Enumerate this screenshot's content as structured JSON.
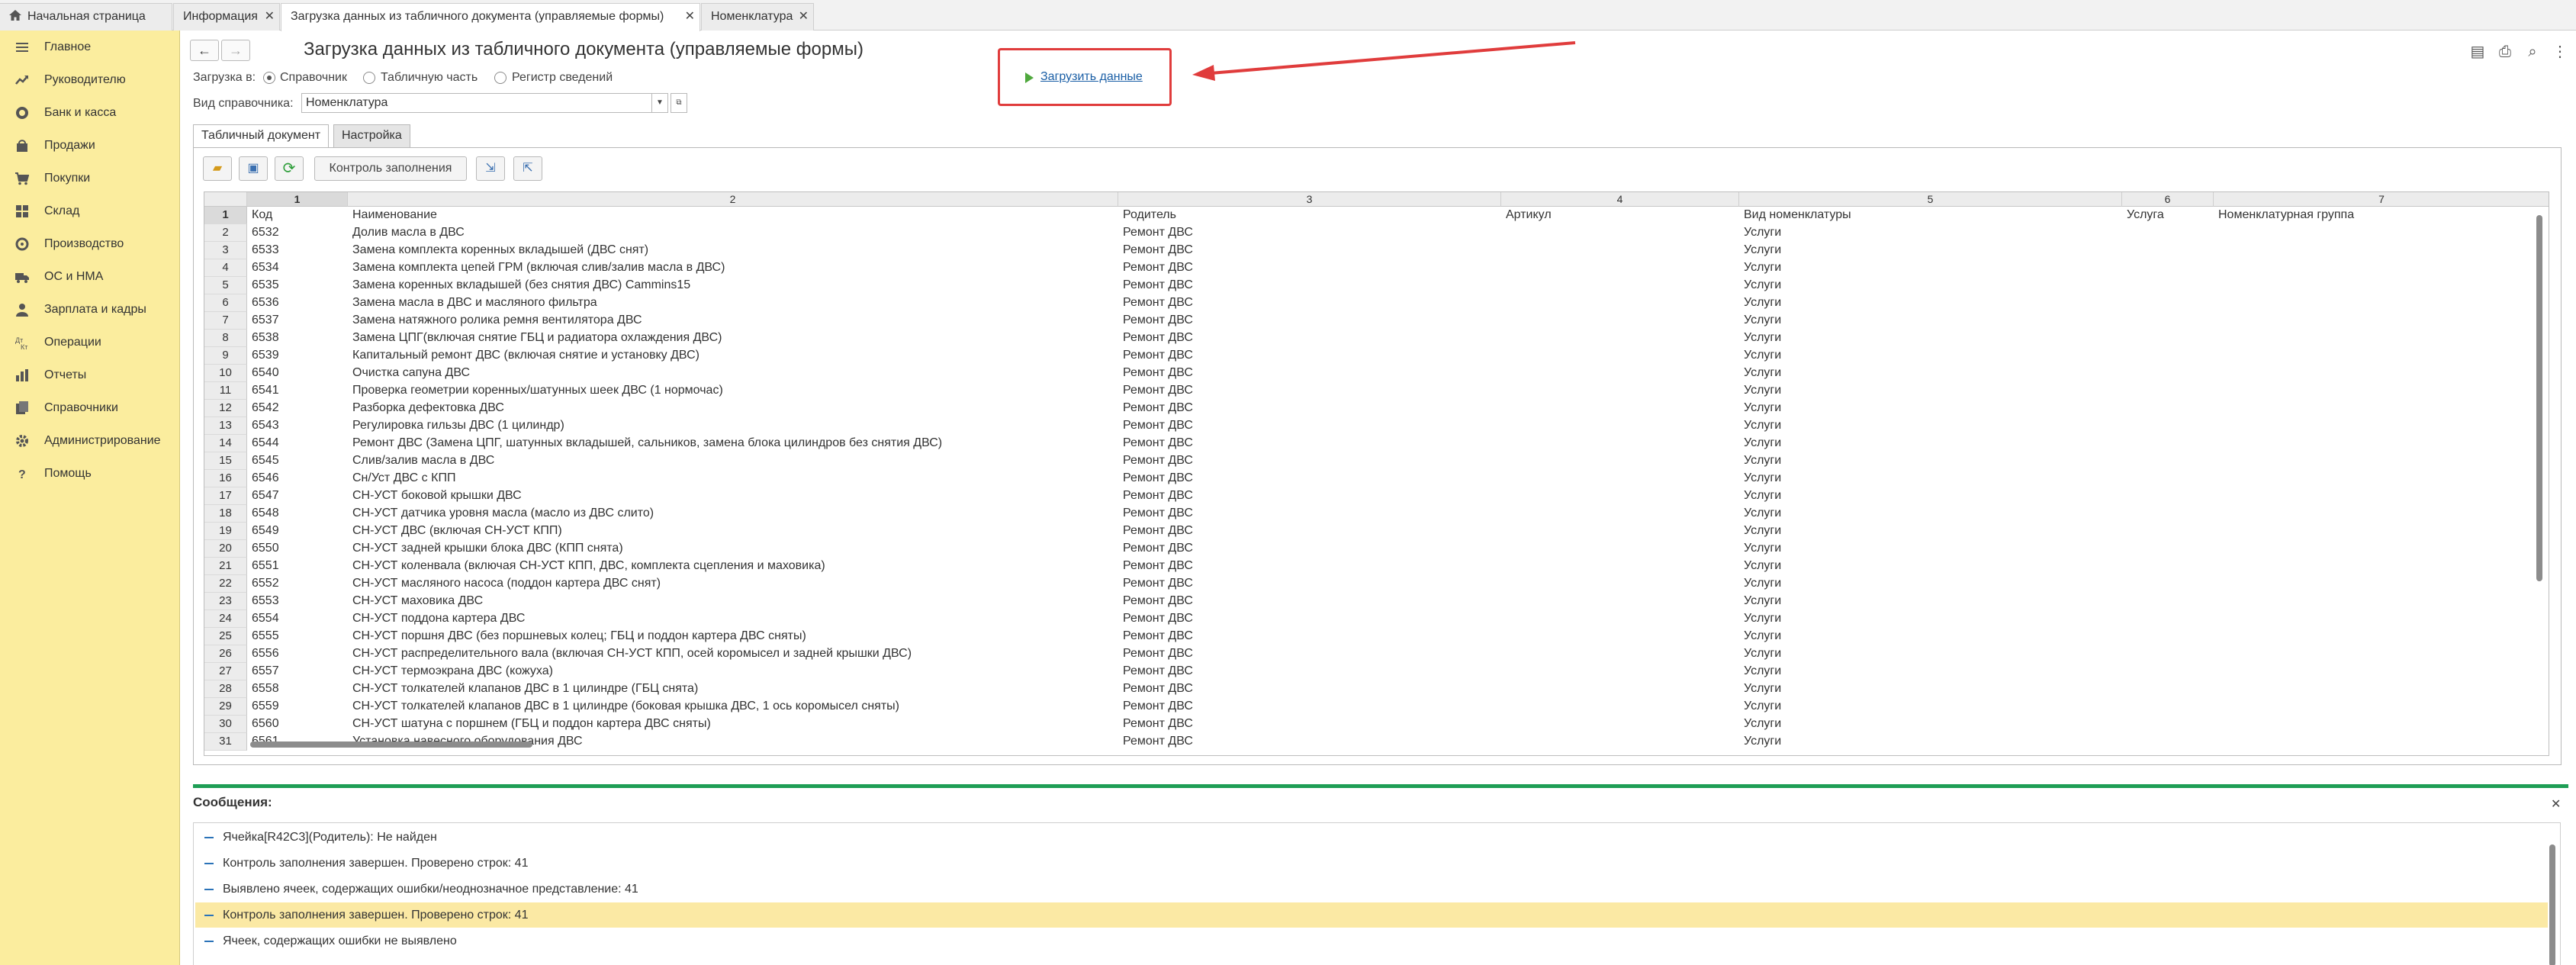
{
  "tabs": [
    {
      "label": "Начальная страница",
      "closable": false
    },
    {
      "label": "Информация",
      "closable": true
    },
    {
      "label": "Загрузка данных из табличного документа (управляемые формы)",
      "closable": true,
      "active": true
    },
    {
      "label": "Номенклатура",
      "closable": true
    }
  ],
  "sidebar": {
    "items": [
      {
        "label": "Главное",
        "icon": "menu-icon"
      },
      {
        "label": "Руководителю",
        "icon": "trend-icon"
      },
      {
        "label": "Банк и касса",
        "icon": "coins-icon"
      },
      {
        "label": "Продажи",
        "icon": "bag-icon"
      },
      {
        "label": "Покупки",
        "icon": "cart-icon"
      },
      {
        "label": "Склад",
        "icon": "warehouse-icon"
      },
      {
        "label": "Производство",
        "icon": "factory-icon"
      },
      {
        "label": "ОС и НМА",
        "icon": "truck-icon"
      },
      {
        "label": "Зарплата и кадры",
        "icon": "person-icon"
      },
      {
        "label": "Операции",
        "icon": "operations-icon"
      },
      {
        "label": "Отчеты",
        "icon": "chart-icon"
      },
      {
        "label": "Справочники",
        "icon": "books-icon"
      },
      {
        "label": "Администрирование",
        "icon": "gear-icon"
      },
      {
        "label": "Помощь",
        "icon": "help-icon"
      }
    ]
  },
  "form": {
    "title": "Загрузка данных из табличного документа (управляемые формы)",
    "load_to_label": "Загрузка в:",
    "radios": [
      {
        "label": "Справочник",
        "selected": true
      },
      {
        "label": "Табличную часть",
        "selected": false
      },
      {
        "label": "Регистр сведений",
        "selected": false
      }
    ],
    "catalog_type_label": "Вид справочника:",
    "catalog_type_value": "Номенклатура",
    "load_button": "Загрузить данные",
    "subtabs": [
      "Табличный документ",
      "Настройка"
    ],
    "check_button": "Контроль заполнения"
  },
  "grid": {
    "column_numbers": [
      "1",
      "2",
      "3",
      "4",
      "5",
      "6",
      "7"
    ],
    "header_row": {
      "num": "1",
      "cells": [
        "Код",
        "Наименование",
        "Родитель",
        "Артикул",
        "Вид номенклатуры",
        "Услуга",
        "Номенклатурная группа"
      ]
    },
    "rows": [
      {
        "num": "2",
        "code": "6532",
        "name": "Долив масла в ДВС",
        "parent": "Ремонт ДВС",
        "type": "Услуги"
      },
      {
        "num": "3",
        "code": "6533",
        "name": "Замена комплекта коренных вкладышей (ДВС снят)",
        "parent": "Ремонт ДВС",
        "type": "Услуги"
      },
      {
        "num": "4",
        "code": "6534",
        "name": "Замена комплекта цепей ГРМ  (включая слив/залив масла в ДВС)",
        "parent": "Ремонт ДВС",
        "type": "Услуги"
      },
      {
        "num": "5",
        "code": "6535",
        "name": "Замена коренных вкладышей (без снятия ДВС) Cammins15",
        "parent": "Ремонт ДВС",
        "type": "Услуги"
      },
      {
        "num": "6",
        "code": "6536",
        "name": "Замена масла в ДВС и масляного фильтра",
        "parent": "Ремонт ДВС",
        "type": "Услуги"
      },
      {
        "num": "7",
        "code": "6537",
        "name": "Замена натяжного ролика ремня вентилятора ДВС",
        "parent": "Ремонт ДВС",
        "type": "Услуги"
      },
      {
        "num": "8",
        "code": "6538",
        "name": "Замена ЦПГ(включая снятие ГБЦ и радиатора охлаждения ДВС)",
        "parent": "Ремонт ДВС",
        "type": "Услуги"
      },
      {
        "num": "9",
        "code": "6539",
        "name": "Капитальный ремонт ДВС (включая снятие и установку ДВС)",
        "parent": "Ремонт ДВС",
        "type": "Услуги"
      },
      {
        "num": "10",
        "code": "6540",
        "name": "Очистка сапуна ДВС",
        "parent": "Ремонт ДВС",
        "type": "Услуги"
      },
      {
        "num": "11",
        "code": "6541",
        "name": "Проверка геометрии коренных/шатунных шеек ДВС (1 нормочас)",
        "parent": "Ремонт ДВС",
        "type": "Услуги"
      },
      {
        "num": "12",
        "code": "6542",
        "name": "Разборка дефектовка ДВС",
        "parent": "Ремонт ДВС",
        "type": "Услуги"
      },
      {
        "num": "13",
        "code": "6543",
        "name": "Регулировка гильзы ДВС (1 цилиндр)",
        "parent": "Ремонт ДВС",
        "type": "Услуги"
      },
      {
        "num": "14",
        "code": "6544",
        "name": "Ремонт ДВС (Замена ЦПГ, шатунных вкладышей, сальников, замена блока цилиндров без снятия ДВС)",
        "parent": "Ремонт ДВС",
        "type": "Услуги"
      },
      {
        "num": "15",
        "code": "6545",
        "name": "Слив/залив масла в ДВС",
        "parent": "Ремонт ДВС",
        "type": "Услуги"
      },
      {
        "num": "16",
        "code": "6546",
        "name": "Сн/Уст ДВС с КПП",
        "parent": "Ремонт ДВС",
        "type": "Услуги"
      },
      {
        "num": "17",
        "code": "6547",
        "name": "СН-УСТ боковой крышки ДВС",
        "parent": "Ремонт ДВС",
        "type": "Услуги"
      },
      {
        "num": "18",
        "code": "6548",
        "name": "СН-УСТ датчика уровня масла (масло из ДВС слито)",
        "parent": "Ремонт ДВС",
        "type": "Услуги"
      },
      {
        "num": "19",
        "code": "6549",
        "name": "СН-УСТ ДВС (включая СН-УСТ КПП)",
        "parent": "Ремонт ДВС",
        "type": "Услуги"
      },
      {
        "num": "20",
        "code": "6550",
        "name": "СН-УСТ задней крышки блока ДВС (КПП снята)",
        "parent": "Ремонт ДВС",
        "type": "Услуги"
      },
      {
        "num": "21",
        "code": "6551",
        "name": "СН-УСТ коленвала (включая СН-УСТ КПП, ДВС, комплекта сцепления и маховика)",
        "parent": "Ремонт ДВС",
        "type": "Услуги"
      },
      {
        "num": "22",
        "code": "6552",
        "name": "СН-УСТ масляного насоса (поддон картера ДВС снят)",
        "parent": "Ремонт ДВС",
        "type": "Услуги"
      },
      {
        "num": "23",
        "code": "6553",
        "name": "СН-УСТ маховика ДВС",
        "parent": "Ремонт ДВС",
        "type": "Услуги"
      },
      {
        "num": "24",
        "code": "6554",
        "name": "СН-УСТ поддона картера ДВС",
        "parent": "Ремонт ДВС",
        "type": "Услуги"
      },
      {
        "num": "25",
        "code": "6555",
        "name": "СН-УСТ поршня ДВС (без поршневых колец; ГБЦ и поддон картера ДВС сняты)",
        "parent": "Ремонт ДВС",
        "type": "Услуги"
      },
      {
        "num": "26",
        "code": "6556",
        "name": "СН-УСТ распределительного вала (включая СН-УСТ КПП, осей коромысел и задней крышки ДВС)",
        "parent": "Ремонт ДВС",
        "type": "Услуги"
      },
      {
        "num": "27",
        "code": "6557",
        "name": "СН-УСТ термоэкрана ДВС (кожуха)",
        "parent": "Ремонт ДВС",
        "type": "Услуги"
      },
      {
        "num": "28",
        "code": "6558",
        "name": "СН-УСТ толкателей клапанов ДВС в 1 цилиндре  (ГБЦ снята)",
        "parent": "Ремонт ДВС",
        "type": "Услуги"
      },
      {
        "num": "29",
        "code": "6559",
        "name": "СН-УСТ толкателей клапанов ДВС в 1 цилиндре  (боковая крышка ДВС, 1 ось коромысел сняты)",
        "parent": "Ремонт ДВС",
        "type": "Услуги"
      },
      {
        "num": "30",
        "code": "6560",
        "name": "СН-УСТ шатуна с поршнем (ГБЦ и поддон картера ДВС сняты)",
        "parent": "Ремонт ДВС",
        "type": "Услуги"
      },
      {
        "num": "31",
        "code": "6561",
        "name": "Установка навесного оборудования ДВС",
        "parent": "Ремонт ДВС",
        "type": "Услуги"
      }
    ]
  },
  "messages": {
    "title": "Сообщения:",
    "items": [
      {
        "text": "Ячейка[R42C3](Родитель): Не найден",
        "highlight": false
      },
      {
        "text": "Контроль заполнения завершен. Проверено строк: 41",
        "highlight": false
      },
      {
        "text": "Выявлено ячеек, содержащих ошибки/неоднозначное представление: 41",
        "highlight": false
      },
      {
        "text": "Контроль заполнения завершен. Проверено строк: 41",
        "highlight": true
      },
      {
        "text": "Ячеек, содержащих ошибки не выявлено",
        "highlight": false
      }
    ]
  },
  "colors": {
    "sidebar": "#fbed9e",
    "accent_green": "#1e9e55",
    "highlight_red": "#e03c3c",
    "link": "#1b5fa6",
    "message_highlight": "#fbe9a4"
  }
}
